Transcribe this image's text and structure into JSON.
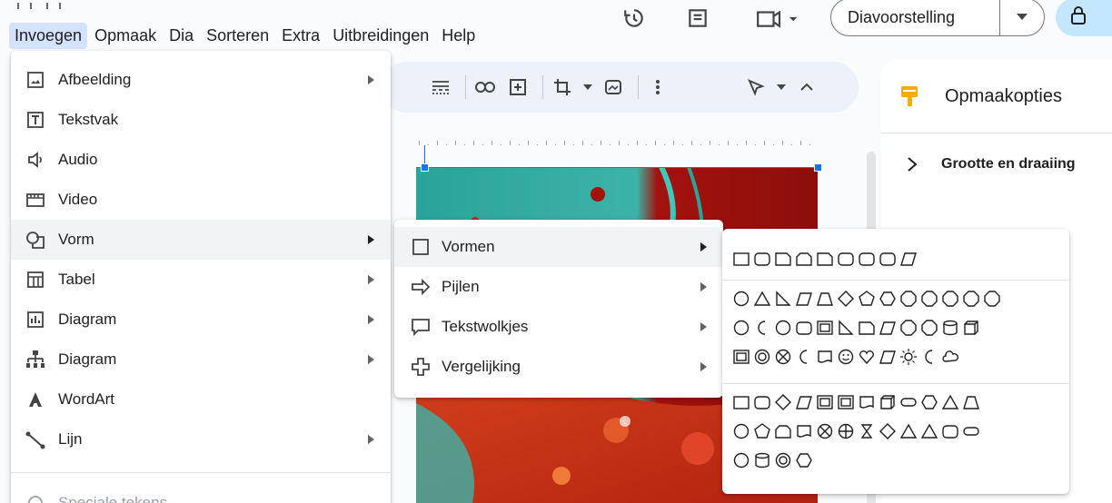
{
  "menubar": [
    "Invoegen",
    "Opmaak",
    "Dia",
    "Sorteren",
    "Extra",
    "Uitbreidingen",
    "Help"
  ],
  "header": {
    "slideshow_label": "Diavoorstelling"
  },
  "rightpanel": {
    "title": "Opmaakopties",
    "section": "Grootte en draaiing"
  },
  "insert_menu": {
    "items": [
      {
        "label": "Afbeelding",
        "icon": "image-icon",
        "submenu": true
      },
      {
        "label": "Tekstvak",
        "icon": "textbox-icon",
        "submenu": false
      },
      {
        "label": "Audio",
        "icon": "audio-icon",
        "submenu": false
      },
      {
        "label": "Video",
        "icon": "video-icon",
        "submenu": false
      },
      {
        "label": "Vorm",
        "icon": "shape-icon",
        "submenu": true,
        "highlighted": true
      },
      {
        "label": "Tabel",
        "icon": "table-icon",
        "submenu": true
      },
      {
        "label": "Diagram",
        "icon": "chart-icon",
        "submenu": true
      },
      {
        "label": "Diagram",
        "icon": "org-diagram-icon",
        "submenu": true
      },
      {
        "label": "WordArt",
        "icon": "wordart-icon",
        "submenu": false
      },
      {
        "label": "Lijn",
        "icon": "line-icon",
        "submenu": true
      },
      {
        "label": "Speciale tekens",
        "icon": "special-chars-icon",
        "submenu": false,
        "disabled": true
      }
    ]
  },
  "shape_menu": {
    "items": [
      {
        "label": "Vormen",
        "icon": "square-icon"
      },
      {
        "label": "Pijlen",
        "icon": "arrow-icon"
      },
      {
        "label": "Tekstwolkjes",
        "icon": "callout-icon"
      },
      {
        "label": "Vergelijking",
        "icon": "equation-icon"
      }
    ]
  },
  "shapes_palette": {
    "groups": [
      {
        "name": "rectangles",
        "count": 9
      },
      {
        "name": "basic",
        "count": 37
      },
      {
        "name": "flowchart",
        "count": 28
      }
    ]
  },
  "colors": {
    "accent": "#1a73e8",
    "highlight": "#d3e3fd",
    "share": "#c2e7ff"
  }
}
